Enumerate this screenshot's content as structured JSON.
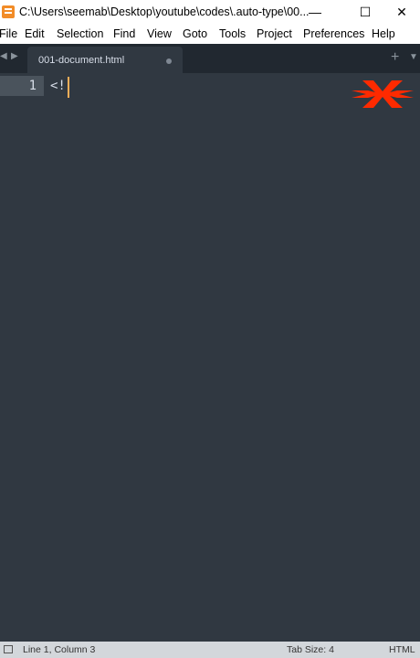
{
  "window": {
    "title": "C:\\Users\\seemab\\Desktop\\youtube\\codes\\.auto-type\\00...",
    "controls": {
      "minimize": "—",
      "maximize": "☐",
      "close": "✕"
    }
  },
  "menu": {
    "items": [
      "File",
      "Edit",
      "Selection",
      "Find",
      "View",
      "Goto",
      "Tools",
      "Project",
      "Preferences",
      "Help"
    ]
  },
  "tabs": {
    "active": {
      "label": "001-document.html",
      "dirty": true
    },
    "nav_left": "◀",
    "nav_right": "▶",
    "new_tab": "+",
    "tab_menu": "▼"
  },
  "editor": {
    "line_number": "1",
    "line_text": "<!",
    "colors": {
      "background": "#303841",
      "gutter_highlight": "#4a535c",
      "cursor": "#f9ae58",
      "logo": "#ff2a00"
    }
  },
  "statusbar": {
    "position": "Line 1, Column 3",
    "tab_size": "Tab Size: 4",
    "syntax": "HTML"
  }
}
